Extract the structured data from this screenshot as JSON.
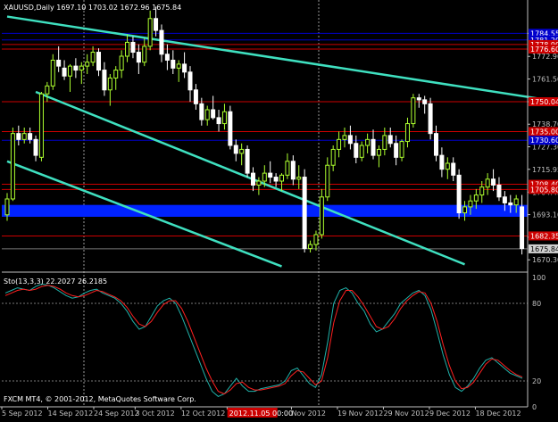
{
  "window": {
    "symbol_header": "XAUUSD,Daily  1697.10 1703.02 1672.96 1675.84",
    "osc_header": "Sto(13,3,3) 22.2027 26.2185",
    "copyright": "FXCM MT4, © 2001-2012, MetaQuotes Software Corp.",
    "cursor_time_label": "2012.11.05 00:00"
  },
  "colors": {
    "background": "#000000",
    "axis": "#c0c0c0",
    "grid": "#5a5a5a",
    "bull": "#adff2f",
    "bear": "#ffffff",
    "channel": "#3fe0c0",
    "zone": "#0022ff",
    "hline_red": "#cc0000",
    "hline_blue": "#0000cc",
    "sto_main": "#20b2aa",
    "sto_signal": "#ff2020",
    "price_tag_red": "#cc0000",
    "price_tag_blue": "#0000cc",
    "current_price_tag": "#d0d0d0"
  },
  "chart_data": [
    {
      "type": "candlestick",
      "title": "XAUUSD,Daily",
      "ylim": [
        1665,
        1800
      ],
      "price_scale_labels": [
        "1784.55",
        "1772.90",
        "1761.50",
        "1750.04",
        "1738.70",
        "1727.30",
        "1715.95",
        "1704.45",
        "1693.10",
        "1681.70",
        "1670.30"
      ],
      "x_labels": [
        "5 Sep 2012",
        "14 Sep 2012",
        "24 Sep 2012",
        "3 Oct 2012",
        "12 Oct 2012",
        "22 Oct 2012",
        "2012.11.05 00:00",
        "Nov 2012",
        "19 Nov 2012",
        "29 Nov 2012",
        "9 Dec 2012",
        "18 Dec 2012"
      ],
      "candles": [
        [
          1693,
          1704,
          1690,
          1701
        ],
        [
          1701,
          1737,
          1700,
          1734
        ],
        [
          1734,
          1738,
          1728,
          1731
        ],
        [
          1731,
          1737,
          1729,
          1734
        ],
        [
          1734,
          1737,
          1729,
          1731
        ],
        [
          1731,
          1733,
          1720,
          1723
        ],
        [
          1722,
          1755,
          1720,
          1754
        ],
        [
          1754,
          1760,
          1750,
          1758
        ],
        [
          1758,
          1774,
          1756,
          1771
        ],
        [
          1771,
          1778,
          1765,
          1768
        ],
        [
          1767,
          1771,
          1761,
          1763
        ],
        [
          1763,
          1769,
          1755,
          1768
        ],
        [
          1768,
          1772,
          1762,
          1766
        ],
        [
          1766,
          1770,
          1759,
          1768
        ],
        [
          1768,
          1774,
          1764,
          1770
        ],
        [
          1770,
          1778,
          1768,
          1775
        ],
        [
          1775,
          1777,
          1763,
          1766
        ],
        [
          1766,
          1770,
          1753,
          1756
        ],
        [
          1756,
          1764,
          1748,
          1762
        ],
        [
          1762,
          1768,
          1756,
          1766
        ],
        [
          1766,
          1776,
          1762,
          1773
        ],
        [
          1773,
          1784,
          1770,
          1780
        ],
        [
          1780,
          1783,
          1772,
          1775
        ],
        [
          1775,
          1779,
          1764,
          1770
        ],
        [
          1770,
          1782,
          1768,
          1778
        ],
        [
          1778,
          1796,
          1776,
          1792
        ],
        [
          1792,
          1798,
          1783,
          1786
        ],
        [
          1786,
          1789,
          1770,
          1774
        ],
        [
          1774,
          1779,
          1766,
          1771
        ],
        [
          1771,
          1776,
          1764,
          1767
        ],
        [
          1767,
          1771,
          1760,
          1769
        ],
        [
          1769,
          1775,
          1762,
          1765
        ],
        [
          1765,
          1768,
          1750,
          1756
        ],
        [
          1756,
          1759,
          1746,
          1749
        ],
        [
          1749,
          1752,
          1738,
          1741
        ],
        [
          1741,
          1748,
          1738,
          1746
        ],
        [
          1746,
          1753,
          1741,
          1742
        ],
        [
          1742,
          1746,
          1735,
          1739
        ],
        [
          1739,
          1749,
          1736,
          1745
        ],
        [
          1745,
          1748,
          1726,
          1728
        ],
        [
          1728,
          1731,
          1720,
          1724
        ],
        [
          1724,
          1729,
          1718,
          1726
        ],
        [
          1726,
          1728,
          1712,
          1714
        ],
        [
          1714,
          1717,
          1705,
          1708
        ],
        [
          1708,
          1712,
          1703,
          1710
        ],
        [
          1710,
          1718,
          1707,
          1714
        ],
        [
          1714,
          1720,
          1709,
          1712
        ],
        [
          1712,
          1714,
          1707,
          1710
        ],
        [
          1710,
          1714,
          1705,
          1713
        ],
        [
          1713,
          1724,
          1711,
          1720
        ],
        [
          1720,
          1723,
          1708,
          1711
        ],
        [
          1711,
          1718,
          1706,
          1712
        ],
        [
          1712,
          1716,
          1674,
          1676
        ],
        [
          1676,
          1680,
          1674,
          1678
        ],
        [
          1678,
          1685,
          1675,
          1683
        ],
        [
          1683,
          1706,
          1681,
          1702
        ],
        [
          1702,
          1722,
          1700,
          1718
        ],
        [
          1718,
          1728,
          1715,
          1726
        ],
        [
          1726,
          1735,
          1722,
          1731
        ],
        [
          1731,
          1737,
          1727,
          1733
        ],
        [
          1733,
          1738,
          1726,
          1729
        ],
        [
          1729,
          1733,
          1719,
          1722
        ],
        [
          1722,
          1730,
          1720,
          1728
        ],
        [
          1728,
          1734,
          1724,
          1731
        ],
        [
          1731,
          1736,
          1721,
          1723
        ],
        [
          1723,
          1728,
          1717,
          1726
        ],
        [
          1726,
          1737,
          1723,
          1733
        ],
        [
          1733,
          1737,
          1727,
          1729
        ],
        [
          1729,
          1733,
          1718,
          1722
        ],
        [
          1722,
          1731,
          1720,
          1730
        ],
        [
          1730,
          1742,
          1727,
          1739
        ],
        [
          1739,
          1754,
          1737,
          1752
        ],
        [
          1752,
          1754,
          1747,
          1751
        ],
        [
          1751,
          1753,
          1744,
          1749
        ],
        [
          1749,
          1752,
          1731,
          1734
        ],
        [
          1734,
          1738,
          1720,
          1723
        ],
        [
          1723,
          1727,
          1712,
          1716
        ],
        [
          1716,
          1722,
          1711,
          1719
        ],
        [
          1719,
          1722,
          1710,
          1713
        ],
        [
          1713,
          1716,
          1691,
          1694
        ],
        [
          1694,
          1700,
          1690,
          1697
        ],
        [
          1697,
          1703,
          1693,
          1700
        ],
        [
          1700,
          1706,
          1696,
          1703
        ],
        [
          1703,
          1710,
          1699,
          1707
        ],
        [
          1707,
          1714,
          1703,
          1711
        ],
        [
          1711,
          1716,
          1705,
          1708
        ],
        [
          1708,
          1712,
          1700,
          1702
        ],
        [
          1702,
          1705,
          1695,
          1699
        ],
        [
          1699,
          1703,
          1694,
          1698
        ],
        [
          1698,
          1703,
          1694,
          1701
        ],
        [
          1697,
          1703,
          1673,
          1676
        ]
      ],
      "channel_lines": [
        {
          "start": [
            0,
            1793
          ],
          "end": [
            137,
            1732
          ]
        },
        {
          "start": [
            5,
            1755
          ],
          "end": [
            80,
            1668
          ]
        },
        {
          "start": [
            0,
            1720
          ],
          "end": [
            48,
            1667
          ]
        }
      ],
      "zone": [
        1692,
        1698
      ],
      "levels": [
        {
          "price": 1784.55,
          "color": "blue",
          "label": "1784.55"
        },
        {
          "price": 1781.2,
          "color": "blue",
          "label": "1781.20"
        },
        {
          "price": 1778.9,
          "color": "red",
          "label": "1778.90"
        },
        {
          "price": 1776.6,
          "color": "red",
          "label": "1776.60"
        },
        {
          "price": 1750.04,
          "color": "red",
          "label": "1750.04"
        },
        {
          "price": 1735.0,
          "color": "red",
          "label": "1735.00"
        },
        {
          "price": 1730.6,
          "color": "blue",
          "label": "1730.60"
        },
        {
          "price": 1708.4,
          "color": "red",
          "label": "1708.40"
        },
        {
          "price": 1705.8,
          "color": "red",
          "label": "1705.80"
        },
        {
          "price": 1682.35,
          "color": "red",
          "label": "1682.35"
        }
      ],
      "current_price": 1675.84,
      "current_price_label": "1675.84"
    },
    {
      "type": "line",
      "title": "Sto(13,3,3)",
      "ylim": [
        0,
        100
      ],
      "y_ticks": [
        "100",
        "80",
        "20",
        "0"
      ],
      "series": [
        {
          "name": "main",
          "values": [
            88,
            90,
            92,
            91,
            90,
            93,
            95,
            94,
            92,
            89,
            86,
            84,
            85,
            88,
            90,
            91,
            88,
            86,
            84,
            80,
            74,
            66,
            60,
            62,
            70,
            78,
            82,
            84,
            80,
            70,
            58,
            46,
            34,
            22,
            12,
            8,
            10,
            16,
            22,
            16,
            12,
            12,
            14,
            15,
            16,
            17,
            20,
            28,
            30,
            24,
            18,
            15,
            25,
            50,
            80,
            90,
            92,
            88,
            80,
            74,
            64,
            58,
            60,
            66,
            72,
            80,
            84,
            88,
            90,
            86,
            75,
            58,
            40,
            25,
            15,
            12,
            16,
            22,
            30,
            36,
            38,
            34,
            30,
            26,
            24,
            22
          ]
        },
        {
          "name": "signal",
          "values": [
            86,
            88,
            90,
            91,
            90,
            91,
            93,
            94,
            93,
            91,
            88,
            86,
            85,
            86,
            88,
            90,
            89,
            87,
            85,
            82,
            77,
            70,
            64,
            62,
            66,
            73,
            79,
            82,
            82,
            76,
            66,
            54,
            42,
            30,
            20,
            12,
            10,
            13,
            18,
            19,
            15,
            13,
            13,
            14,
            15,
            16,
            18,
            24,
            28,
            27,
            22,
            17,
            20,
            38,
            65,
            82,
            90,
            90,
            85,
            78,
            70,
            62,
            60,
            62,
            68,
            76,
            82,
            86,
            89,
            88,
            80,
            66,
            48,
            32,
            20,
            14,
            15,
            19,
            26,
            33,
            37,
            36,
            32,
            28,
            25,
            23
          ]
        }
      ]
    }
  ]
}
